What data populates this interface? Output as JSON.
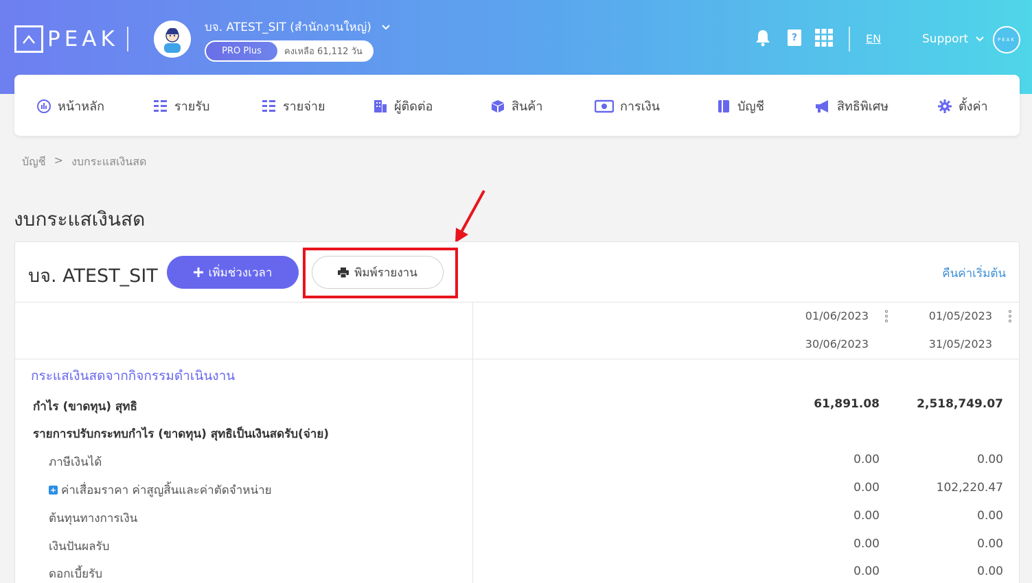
{
  "header": {
    "logo_text": "PEAK",
    "company_name": "บจ. ATEST_SIT (สำนักงานใหญ่)",
    "plan": "PRO Plus",
    "remaining": "คงเหลือ 61,112 วัน",
    "language": "EN",
    "support": "Support",
    "mini_logo_text": "PEAK",
    "icons": [
      "bell-icon",
      "help-book-icon",
      "apps-grid-icon"
    ],
    "colors": {
      "gradient_start": "#6e7ff0",
      "gradient_end": "#4fd6e9"
    }
  },
  "nav": {
    "items": [
      {
        "label": "หน้าหลัก",
        "icon": "dashboard-icon"
      },
      {
        "label": "รายรับ",
        "icon": "income-icon"
      },
      {
        "label": "รายจ่าย",
        "icon": "expense-icon"
      },
      {
        "label": "ผู้ติดต่อ",
        "icon": "contacts-icon"
      },
      {
        "label": "สินค้า",
        "icon": "product-box-icon"
      },
      {
        "label": "การเงิน",
        "icon": "money-icon"
      },
      {
        "label": "บัญชี",
        "icon": "accounting-book-icon"
      },
      {
        "label": "สิทธิพิเศษ",
        "icon": "megaphone-icon"
      },
      {
        "label": "ตั้งค่า",
        "icon": "gear-icon"
      }
    ]
  },
  "breadcrumb": {
    "parent": "บัญชี",
    "separator": ">",
    "current": "งบกระแสเงินสด"
  },
  "page": {
    "title": "งบกระแสเงินสด"
  },
  "report": {
    "company": "บจ. ATEST_SIT",
    "add_period_label": "เพิ่มช่วงเวลา",
    "print_label": "พิมพ์รายงาน",
    "reset_label": "คืนค่าเริ่มต้น",
    "periods": [
      {
        "start": "01/06/2023",
        "end": "30/06/2023"
      },
      {
        "start": "01/05/2023",
        "end": "31/05/2023"
      }
    ],
    "section_title": "กระแสเงินสดจากกิจกรรมดำเนินงาน",
    "rows": [
      {
        "label": "กำไร (ขาดทุน) สุทธิ",
        "values": [
          "61,891.08",
          "2,518,749.07"
        ]
      },
      {
        "label": "รายการปรับกระทบกำไร (ขาดทุน) สุทธิเป็นเงินสดรับ(จ่าย)",
        "values": []
      },
      {
        "label": "ภาษีเงินได้",
        "values": [
          "0.00",
          "0.00"
        ]
      },
      {
        "label": "ค่าเสื่อมราคา ค่าสูญสิ้นและค่าตัดจำหน่าย",
        "values": [
          "0.00",
          "102,220.47"
        ]
      },
      {
        "label": "ต้นทุนทางการเงิน",
        "values": [
          "0.00",
          "0.00"
        ]
      },
      {
        "label": "เงินปันผลรับ",
        "values": [
          "0.00",
          "0.00"
        ]
      },
      {
        "label": "ดอกเบี้ยรับ",
        "values": [
          "0.00",
          "0.00"
        ]
      }
    ]
  }
}
